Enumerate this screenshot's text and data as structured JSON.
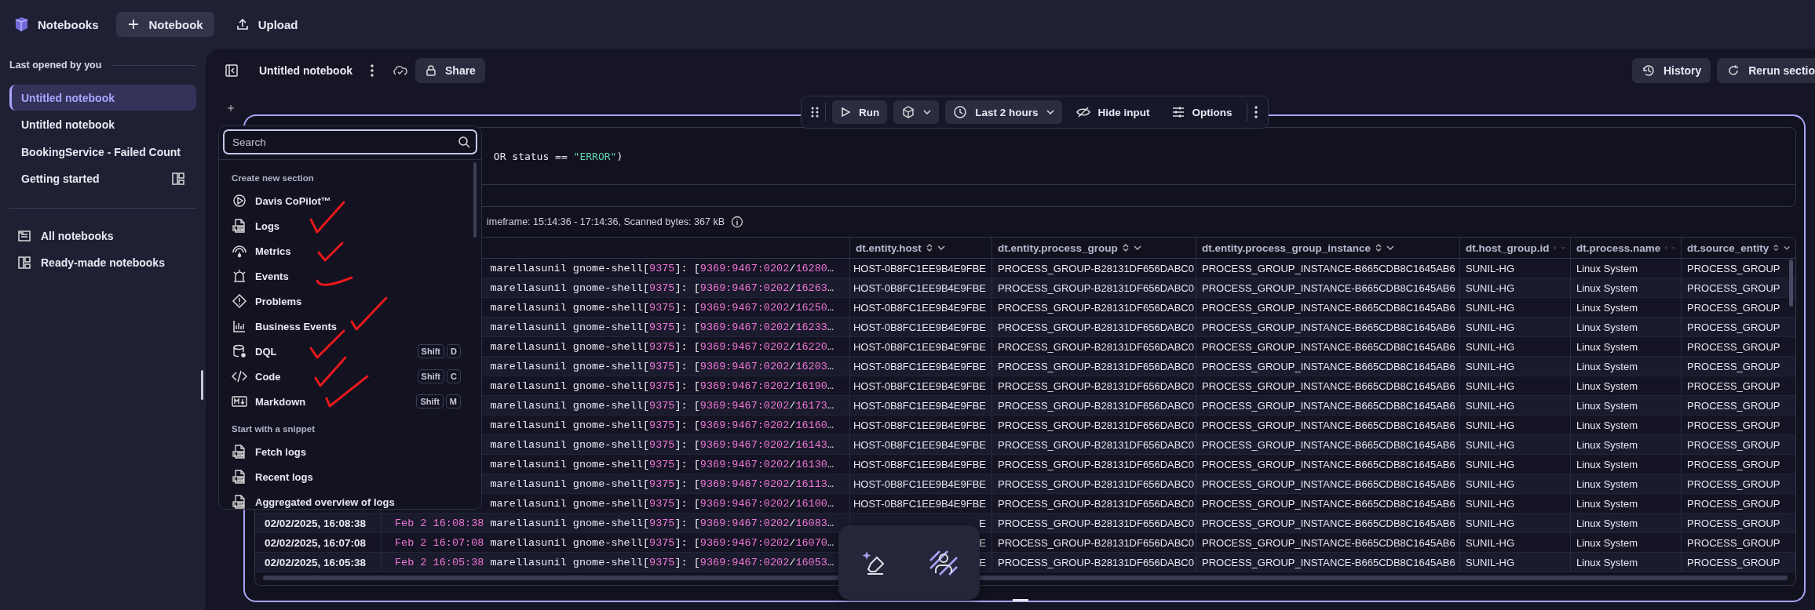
{
  "app_bar": {
    "title": "Notebooks",
    "buttons": [
      {
        "label": "Notebook",
        "kind": "add",
        "selected": true
      },
      {
        "label": "Upload",
        "kind": "upload",
        "selected": false
      }
    ]
  },
  "sidebar": {
    "heading": "Last opened by you",
    "recent": [
      {
        "label": "Untitled notebook",
        "selected": true,
        "kind": "notebook"
      },
      {
        "label": "Untitled notebook",
        "selected": false,
        "kind": "notebook"
      },
      {
        "label": "BookingService - Failed Count",
        "selected": false,
        "kind": "notebook"
      },
      {
        "label": "Getting started",
        "selected": false,
        "kind": "template"
      }
    ],
    "links": [
      {
        "label": "All notebooks",
        "kind": "list"
      },
      {
        "label": "Ready-made notebooks",
        "kind": "template"
      }
    ]
  },
  "notebook": {
    "title": "Untitled notebook",
    "share": "Share",
    "history": "History",
    "rerun": "Rerun sectio"
  },
  "section_toolbar": {
    "run": "Run",
    "timeframe": "Last 2 hours",
    "hide_input": "Hide input",
    "options": "Options"
  },
  "query": [
    {
      "text": " OR status == ",
      "kind": "plain"
    },
    {
      "text": "\"ERROR\"",
      "kind": "string"
    },
    {
      "text": ")",
      "kind": "plain"
    }
  ],
  "result_info": "imeframe: 15:14:36 - 17:14:36, Scanned bytes: 367 kB",
  "add_menu": {
    "placeholder": "Search",
    "groups": [
      {
        "heading": "Create new section",
        "items": [
          {
            "label": "Davis CoPilot™",
            "kind": "copilot"
          },
          {
            "label": "Logs",
            "kind": "log"
          },
          {
            "label": "Metrics",
            "kind": "metrics"
          },
          {
            "label": "Events",
            "kind": "events"
          },
          {
            "label": "Problems",
            "kind": "problems"
          },
          {
            "label": "Business Events",
            "kind": "bizevents"
          },
          {
            "label": "DQL",
            "kind": "dql",
            "shortcut": [
              "Shift",
              "D"
            ]
          },
          {
            "label": "Code",
            "kind": "code",
            "shortcut": [
              "Shift",
              "C"
            ]
          },
          {
            "label": "Markdown",
            "kind": "markdown",
            "shortcut": [
              "Shift",
              "M"
            ]
          }
        ]
      },
      {
        "heading": "Start with a snippet",
        "items": [
          {
            "label": "Fetch logs",
            "kind": "log"
          },
          {
            "label": "Recent logs",
            "kind": "log"
          },
          {
            "label": "Aggregated overview of logs",
            "kind": "log"
          }
        ]
      }
    ]
  },
  "table": {
    "columns": [
      "dt.entity.host",
      "dt.entity.process_group",
      "dt.entity.process_group_instance",
      "dt.host_group.id",
      "dt.process.name",
      "dt.source_entity"
    ],
    "rows": [
      {
        "message": [
          {
            "text": "marellasunil gnome-shell[",
            "kind": "text"
          },
          {
            "text": "9375",
            "kind": "num"
          },
          {
            "text": "]: [",
            "kind": "text"
          },
          {
            "text": "9369:9467:0202",
            "kind": "num"
          },
          {
            "text": "/",
            "kind": "text"
          },
          {
            "text": "16280",
            "kind": "num"
          },
          {
            "text": "…",
            "kind": "text"
          }
        ],
        "host": "HOST-0B8FC1EE9B4E9FBE",
        "process_group": "PROCESS_GROUP-B28131DF656DABC0",
        "instance": "PROCESS_GROUP_INSTANCE-B665CDB8C1645AB6",
        "host_group": "SUNIL-HG",
        "process_name": "Linux System",
        "source_entity": "PROCESS_GROUP"
      },
      {
        "message": [
          {
            "text": "marellasunil gnome-shell[",
            "kind": "text"
          },
          {
            "text": "9375",
            "kind": "num"
          },
          {
            "text": "]: [",
            "kind": "text"
          },
          {
            "text": "9369:9467:0202",
            "kind": "num"
          },
          {
            "text": "/",
            "kind": "text"
          },
          {
            "text": "16263",
            "kind": "num"
          },
          {
            "text": "…",
            "kind": "text"
          }
        ],
        "host": "HOST-0B8FC1EE9B4E9FBE",
        "process_group": "PROCESS_GROUP-B28131DF656DABC0",
        "instance": "PROCESS_GROUP_INSTANCE-B665CDB8C1645AB6",
        "host_group": "SUNIL-HG",
        "process_name": "Linux System",
        "source_entity": "PROCESS_GROUP"
      },
      {
        "message": [
          {
            "text": "marellasunil gnome-shell[",
            "kind": "text"
          },
          {
            "text": "9375",
            "kind": "num"
          },
          {
            "text": "]: [",
            "kind": "text"
          },
          {
            "text": "9369:9467:0202",
            "kind": "num"
          },
          {
            "text": "/",
            "kind": "text"
          },
          {
            "text": "16250",
            "kind": "num"
          },
          {
            "text": "…",
            "kind": "text"
          }
        ],
        "host": "HOST-0B8FC1EE9B4E9FBE",
        "process_group": "PROCESS_GROUP-B28131DF656DABC0",
        "instance": "PROCESS_GROUP_INSTANCE-B665CDB8C1645AB6",
        "host_group": "SUNIL-HG",
        "process_name": "Linux System",
        "source_entity": "PROCESS_GROUP"
      },
      {
        "message": [
          {
            "text": "marellasunil gnome-shell[",
            "kind": "text"
          },
          {
            "text": "9375",
            "kind": "num"
          },
          {
            "text": "]: [",
            "kind": "text"
          },
          {
            "text": "9369:9467:0202",
            "kind": "num"
          },
          {
            "text": "/",
            "kind": "text"
          },
          {
            "text": "16233",
            "kind": "num"
          },
          {
            "text": "…",
            "kind": "text"
          }
        ],
        "host": "HOST-0B8FC1EE9B4E9FBE",
        "process_group": "PROCESS_GROUP-B28131DF656DABC0",
        "instance": "PROCESS_GROUP_INSTANCE-B665CDB8C1645AB6",
        "host_group": "SUNIL-HG",
        "process_name": "Linux System",
        "source_entity": "PROCESS_GROUP"
      },
      {
        "message": [
          {
            "text": "marellasunil gnome-shell[",
            "kind": "text"
          },
          {
            "text": "9375",
            "kind": "num"
          },
          {
            "text": "]: [",
            "kind": "text"
          },
          {
            "text": "9369:9467:0202",
            "kind": "num"
          },
          {
            "text": "/",
            "kind": "text"
          },
          {
            "text": "16220",
            "kind": "num"
          },
          {
            "text": "…",
            "kind": "text"
          }
        ],
        "host": "HOST-0B8FC1EE9B4E9FBE",
        "process_group": "PROCESS_GROUP-B28131DF656DABC0",
        "instance": "PROCESS_GROUP_INSTANCE-B665CDB8C1645AB6",
        "host_group": "SUNIL-HG",
        "process_name": "Linux System",
        "source_entity": "PROCESS_GROUP"
      },
      {
        "message": [
          {
            "text": "marellasunil gnome-shell[",
            "kind": "text"
          },
          {
            "text": "9375",
            "kind": "num"
          },
          {
            "text": "]: [",
            "kind": "text"
          },
          {
            "text": "9369:9467:0202",
            "kind": "num"
          },
          {
            "text": "/",
            "kind": "text"
          },
          {
            "text": "16203",
            "kind": "num"
          },
          {
            "text": "…",
            "kind": "text"
          }
        ],
        "host": "HOST-0B8FC1EE9B4E9FBE",
        "process_group": "PROCESS_GROUP-B28131DF656DABC0",
        "instance": "PROCESS_GROUP_INSTANCE-B665CDB8C1645AB6",
        "host_group": "SUNIL-HG",
        "process_name": "Linux System",
        "source_entity": "PROCESS_GROUP"
      },
      {
        "message": [
          {
            "text": "marellasunil gnome-shell[",
            "kind": "text"
          },
          {
            "text": "9375",
            "kind": "num"
          },
          {
            "text": "]: [",
            "kind": "text"
          },
          {
            "text": "9369:9467:0202",
            "kind": "num"
          },
          {
            "text": "/",
            "kind": "text"
          },
          {
            "text": "16190",
            "kind": "num"
          },
          {
            "text": "…",
            "kind": "text"
          }
        ],
        "host": "HOST-0B8FC1EE9B4E9FBE",
        "process_group": "PROCESS_GROUP-B28131DF656DABC0",
        "instance": "PROCESS_GROUP_INSTANCE-B665CDB8C1645AB6",
        "host_group": "SUNIL-HG",
        "process_name": "Linux System",
        "source_entity": "PROCESS_GROUP"
      },
      {
        "message": [
          {
            "text": "marellasunil gnome-shell[",
            "kind": "text"
          },
          {
            "text": "9375",
            "kind": "num"
          },
          {
            "text": "]: [",
            "kind": "text"
          },
          {
            "text": "9369:9467:0202",
            "kind": "num"
          },
          {
            "text": "/",
            "kind": "text"
          },
          {
            "text": "16173",
            "kind": "num"
          },
          {
            "text": "…",
            "kind": "text"
          }
        ],
        "host": "HOST-0B8FC1EE9B4E9FBE",
        "process_group": "PROCESS_GROUP-B28131DF656DABC0",
        "instance": "PROCESS_GROUP_INSTANCE-B665CDB8C1645AB6",
        "host_group": "SUNIL-HG",
        "process_name": "Linux System",
        "source_entity": "PROCESS_GROUP"
      },
      {
        "message": [
          {
            "text": "marellasunil gnome-shell[",
            "kind": "text"
          },
          {
            "text": "9375",
            "kind": "num"
          },
          {
            "text": "]: [",
            "kind": "text"
          },
          {
            "text": "9369:9467:0202",
            "kind": "num"
          },
          {
            "text": "/",
            "kind": "text"
          },
          {
            "text": "16160",
            "kind": "num"
          },
          {
            "text": "…",
            "kind": "text"
          }
        ],
        "host": "HOST-0B8FC1EE9B4E9FBE",
        "process_group": "PROCESS_GROUP-B28131DF656DABC0",
        "instance": "PROCESS_GROUP_INSTANCE-B665CDB8C1645AB6",
        "host_group": "SUNIL-HG",
        "process_name": "Linux System",
        "source_entity": "PROCESS_GROUP"
      },
      {
        "message": [
          {
            "text": "marellasunil gnome-shell[",
            "kind": "text"
          },
          {
            "text": "9375",
            "kind": "num"
          },
          {
            "text": "]: [",
            "kind": "text"
          },
          {
            "text": "9369:9467:0202",
            "kind": "num"
          },
          {
            "text": "/",
            "kind": "text"
          },
          {
            "text": "16143",
            "kind": "num"
          },
          {
            "text": "…",
            "kind": "text"
          }
        ],
        "host": "HOST-0B8FC1EE9B4E9FBE",
        "process_group": "PROCESS_GROUP-B28131DF656DABC0",
        "instance": "PROCESS_GROUP_INSTANCE-B665CDB8C1645AB6",
        "host_group": "SUNIL-HG",
        "process_name": "Linux System",
        "source_entity": "PROCESS_GROUP"
      },
      {
        "message": [
          {
            "text": "marellasunil gnome-shell[",
            "kind": "text"
          },
          {
            "text": "9375",
            "kind": "num"
          },
          {
            "text": "]: [",
            "kind": "text"
          },
          {
            "text": "9369:9467:0202",
            "kind": "num"
          },
          {
            "text": "/",
            "kind": "text"
          },
          {
            "text": "16130",
            "kind": "num"
          },
          {
            "text": "…",
            "kind": "text"
          }
        ],
        "host": "HOST-0B8FC1EE9B4E9FBE",
        "process_group": "PROCESS_GROUP-B28131DF656DABC0",
        "instance": "PROCESS_GROUP_INSTANCE-B665CDB8C1645AB6",
        "host_group": "SUNIL-HG",
        "process_name": "Linux System",
        "source_entity": "PROCESS_GROUP"
      },
      {
        "message": [
          {
            "text": "marellasunil gnome-shell[",
            "kind": "text"
          },
          {
            "text": "9375",
            "kind": "num"
          },
          {
            "text": "]: [",
            "kind": "text"
          },
          {
            "text": "9369:9467:0202",
            "kind": "num"
          },
          {
            "text": "/",
            "kind": "text"
          },
          {
            "text": "16113",
            "kind": "num"
          },
          {
            "text": "…",
            "kind": "text"
          }
        ],
        "host": "HOST-0B8FC1EE9B4E9FBE",
        "process_group": "PROCESS_GROUP-B28131DF656DABC0",
        "instance": "PROCESS_GROUP_INSTANCE-B665CDB8C1645AB6",
        "host_group": "SUNIL-HG",
        "process_name": "Linux System",
        "source_entity": "PROCESS_GROUP"
      },
      {
        "message": [
          {
            "text": "marellasunil gnome-shell[",
            "kind": "text"
          },
          {
            "text": "9375",
            "kind": "num"
          },
          {
            "text": "]: [",
            "kind": "text"
          },
          {
            "text": "9369:9467:0202",
            "kind": "num"
          },
          {
            "text": "/",
            "kind": "text"
          },
          {
            "text": "16100",
            "kind": "num"
          },
          {
            "text": "…",
            "kind": "text"
          }
        ],
        "host": "HOST-0B8FC1EE9B4E9FBE",
        "process_group": "PROCESS_GROUP-B28131DF656DABC0",
        "instance": "PROCESS_GROUP_INSTANCE-B665CDB8C1645AB6",
        "host_group": "SUNIL-HG",
        "process_name": "Linux System",
        "source_entity": "PROCESS_GROUP"
      },
      {
        "timestamp": "02/02/2025, 16:08:38",
        "message": [
          {
            "text": "Feb 2 16:08:38",
            "kind": "num"
          },
          {
            "text": " marellasunil gnome-shell[",
            "kind": "text"
          },
          {
            "text": "9375",
            "kind": "num"
          },
          {
            "text": "]: [",
            "kind": "text"
          },
          {
            "text": "9369:9467:0202",
            "kind": "num"
          },
          {
            "text": "/",
            "kind": "text"
          },
          {
            "text": "16083",
            "kind": "num"
          },
          {
            "text": "…",
            "kind": "text"
          }
        ],
        "host": "E",
        "process_group": "PROCESS_GROUP-B28131DF656DABC0",
        "instance": "PROCESS_GROUP_INSTANCE-B665CDB8C1645AB6",
        "host_group": "SUNIL-HG",
        "process_name": "Linux System",
        "source_entity": "PROCESS_GROUP"
      },
      {
        "timestamp": "02/02/2025, 16:07:08",
        "message": [
          {
            "text": "Feb 2 16:07:08",
            "kind": "num"
          },
          {
            "text": " marellasunil gnome-shell[",
            "kind": "text"
          },
          {
            "text": "9375",
            "kind": "num"
          },
          {
            "text": "]: [",
            "kind": "text"
          },
          {
            "text": "9369:9467:0202",
            "kind": "num"
          },
          {
            "text": "/",
            "kind": "text"
          },
          {
            "text": "16070",
            "kind": "num"
          },
          {
            "text": "…",
            "kind": "text"
          }
        ],
        "host": "E",
        "process_group": "PROCESS_GROUP-B28131DF656DABC0",
        "instance": "PROCESS_GROUP_INSTANCE-B665CDB8C1645AB6",
        "host_group": "SUNIL-HG",
        "process_name": "Linux System",
        "source_entity": "PROCESS_GROUP"
      },
      {
        "timestamp": "02/02/2025, 16:05:38",
        "message": [
          {
            "text": "Feb 2 16:05:38",
            "kind": "num"
          },
          {
            "text": " marellasunil gnome-shell[",
            "kind": "text"
          },
          {
            "text": "9375",
            "kind": "num"
          },
          {
            "text": "]: [",
            "kind": "text"
          },
          {
            "text": "9369:9467:0202",
            "kind": "num"
          },
          {
            "text": "/",
            "kind": "text"
          },
          {
            "text": "16053",
            "kind": "num"
          },
          {
            "text": "…",
            "kind": "text"
          }
        ],
        "host": "E",
        "process_group": "PROCESS_GROUP-B28131DF656DABC0",
        "instance": "PROCESS_GROUP_INSTANCE-B665CDB8C1645AB6",
        "host_group": "SUNIL-HG",
        "process_name": "Linux System",
        "source_entity": "PROCESS_GROUP"
      }
    ]
  }
}
